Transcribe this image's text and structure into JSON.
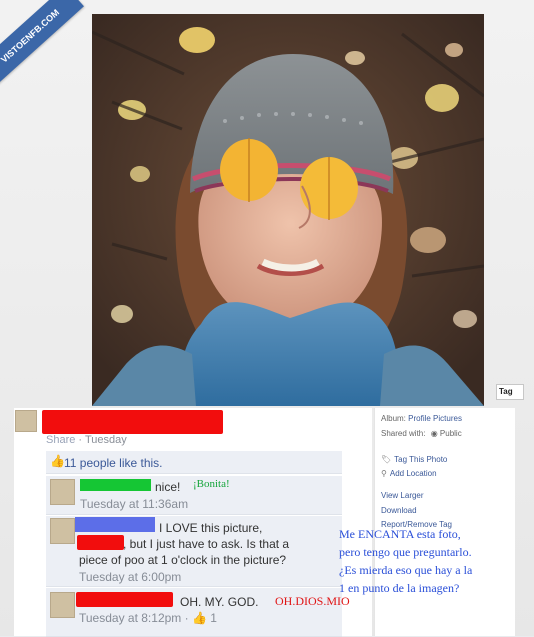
{
  "watermark": {
    "text": "VISTOENFB.COM"
  },
  "photo": {
    "tag_label": "Tag"
  },
  "post": {
    "share_text": "Share",
    "date_text": "Tuesday",
    "likes_text": "11 people like this."
  },
  "comments": [
    {
      "text_suffix": "nice!",
      "annotation": "¡Bonita!",
      "time": "Tuesday at 11:36am"
    },
    {
      "line1_suffix": "I LOVE this picture,",
      "line2_suffix": ", but I just have to ask. Is that a",
      "line3": "piece of poo at 1 o'clock in the picture?",
      "time": "Tuesday at 6:00pm"
    },
    {
      "text_suffix": "OH. MY. GOD.",
      "annotation": "OH.DIOS.MIO",
      "time_visible": "Tuesday at 8:12pm",
      "like_count": "1"
    }
  ],
  "annotation_spanish": [
    "Me ENCANTA esta foto,",
    "pero tengo que preguntarlo.",
    "¿Es mierda eso que hay a la",
    "1 en punto de la imagen?"
  ],
  "sidebar": {
    "album_label": "Album:",
    "album_value": "Profile Pictures",
    "shared_label": "Shared with:",
    "shared_value": "Public",
    "tag_photo": "Tag This Photo",
    "add_location": "Add Location",
    "view_larger": "View Larger",
    "download": "Download",
    "report_remove": "Report/Remove Tag"
  }
}
